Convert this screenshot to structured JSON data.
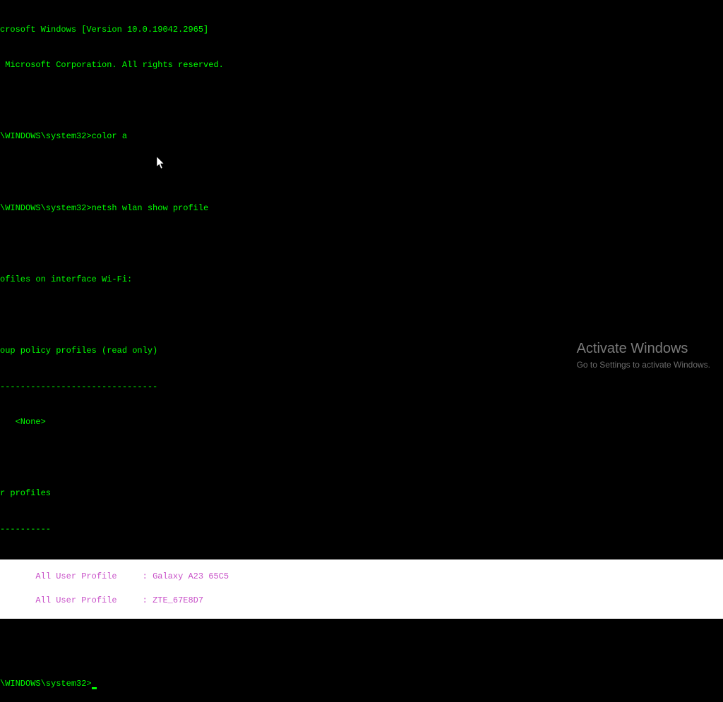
{
  "terminal": {
    "version_line": "crosoft Windows [Version 10.0.19042.2965]",
    "copyright_line": " Microsoft Corporation. All rights reserved.",
    "prompt_path": "\\WINDOWS\\system32>",
    "cmd1": "color a",
    "cmd2": "netsh wlan show profile",
    "heading_profiles": "ofiles on interface Wi-Fi:",
    "group_policy": "oup policy profiles (read only)",
    "dashes1": "-------------------------------",
    "none_entry": "   <None>",
    "user_profiles_heading": "r profiles",
    "dashes2": "----------",
    "profiles": [
      {
        "label": "   All User Profile",
        "sep": "     : ",
        "name": "Galaxy A23 65C5"
      },
      {
        "label": "   All User Profile",
        "sep": "     : ",
        "name": "ZTE_67E8D7"
      }
    ],
    "final_prompt": "\\WINDOWS\\system32>"
  },
  "watermark": {
    "title": "Activate Windows",
    "subtitle": "Go to Settings to activate Windows."
  }
}
